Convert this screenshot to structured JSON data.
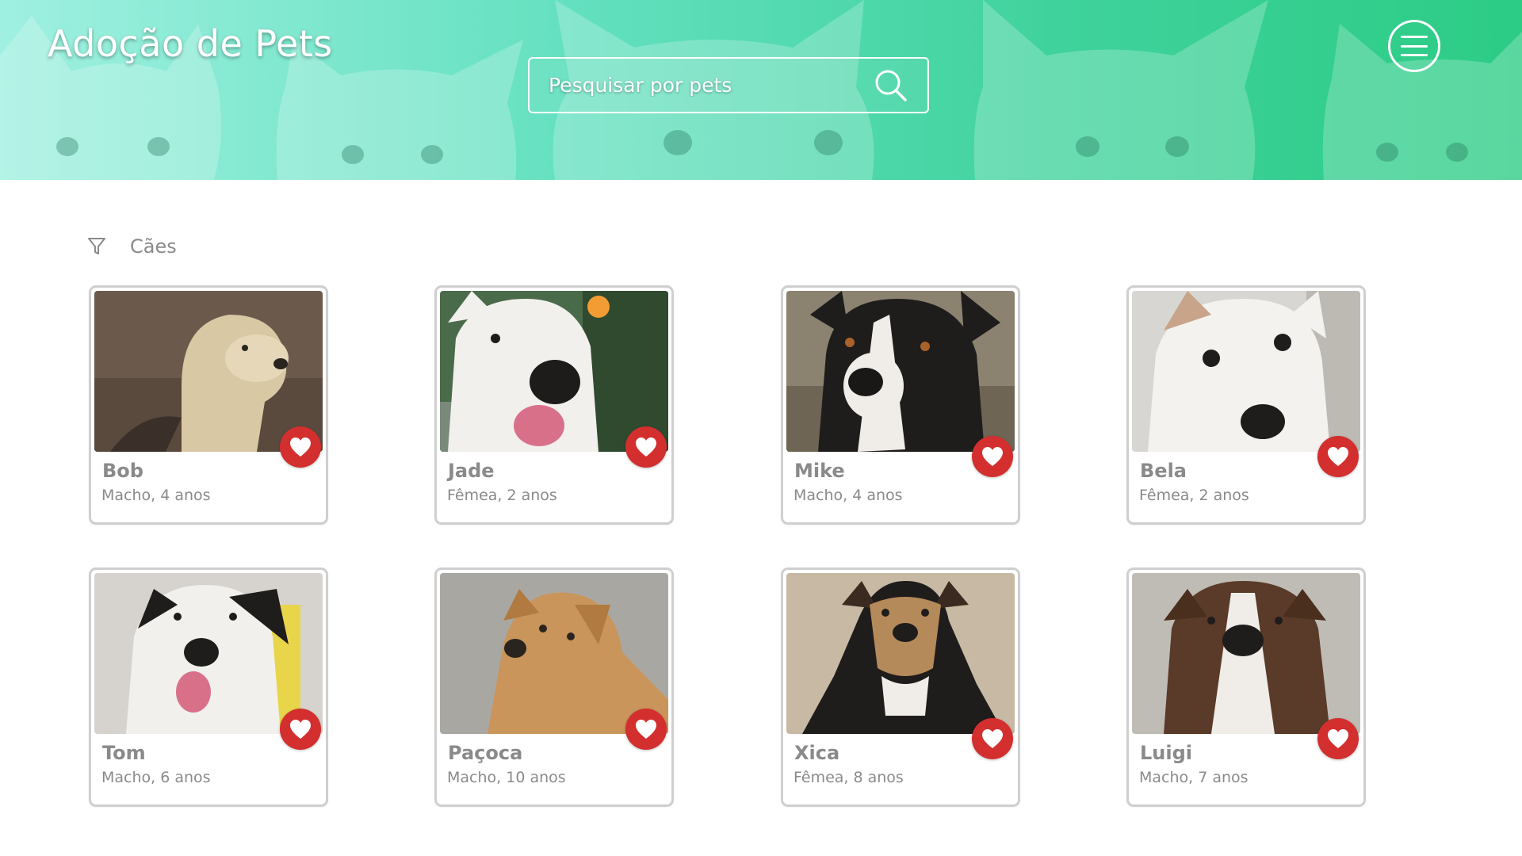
{
  "app": {
    "title": "Adoção de Pets"
  },
  "header": {
    "search_placeholder": "Pesquisar por pets",
    "search_icon": "search-icon",
    "menu_icon": "hamburger-menu-icon"
  },
  "filter": {
    "icon": "filter-icon",
    "label": "Cães"
  },
  "colors": {
    "header_gradient_start": "#9ff0e0",
    "header_gradient_end": "#2ccc85",
    "favorite_button": "#d32f2f",
    "card_border": "#cfcfcf",
    "text_muted": "#8a8a8a"
  },
  "pets": [
    {
      "name": "Bob",
      "info": "Macho, 4 anos",
      "favorite_icon": "heart-icon"
    },
    {
      "name": "Jade",
      "info": "Fêmea, 2 anos",
      "favorite_icon": "heart-icon"
    },
    {
      "name": "Mike",
      "info": "Macho, 4 anos",
      "favorite_icon": "heart-icon"
    },
    {
      "name": "Bela",
      "info": "Fêmea, 2 anos",
      "favorite_icon": "heart-icon"
    },
    {
      "name": "Tom",
      "info": "Macho, 6 anos",
      "favorite_icon": "heart-icon"
    },
    {
      "name": "Paçoca",
      "info": "Macho, 10 anos",
      "favorite_icon": "heart-icon"
    },
    {
      "name": "Xica",
      "info": "Fêmea, 8 anos",
      "favorite_icon": "heart-icon"
    },
    {
      "name": "Luigi",
      "info": "Macho, 7 anos",
      "favorite_icon": "heart-icon"
    }
  ]
}
